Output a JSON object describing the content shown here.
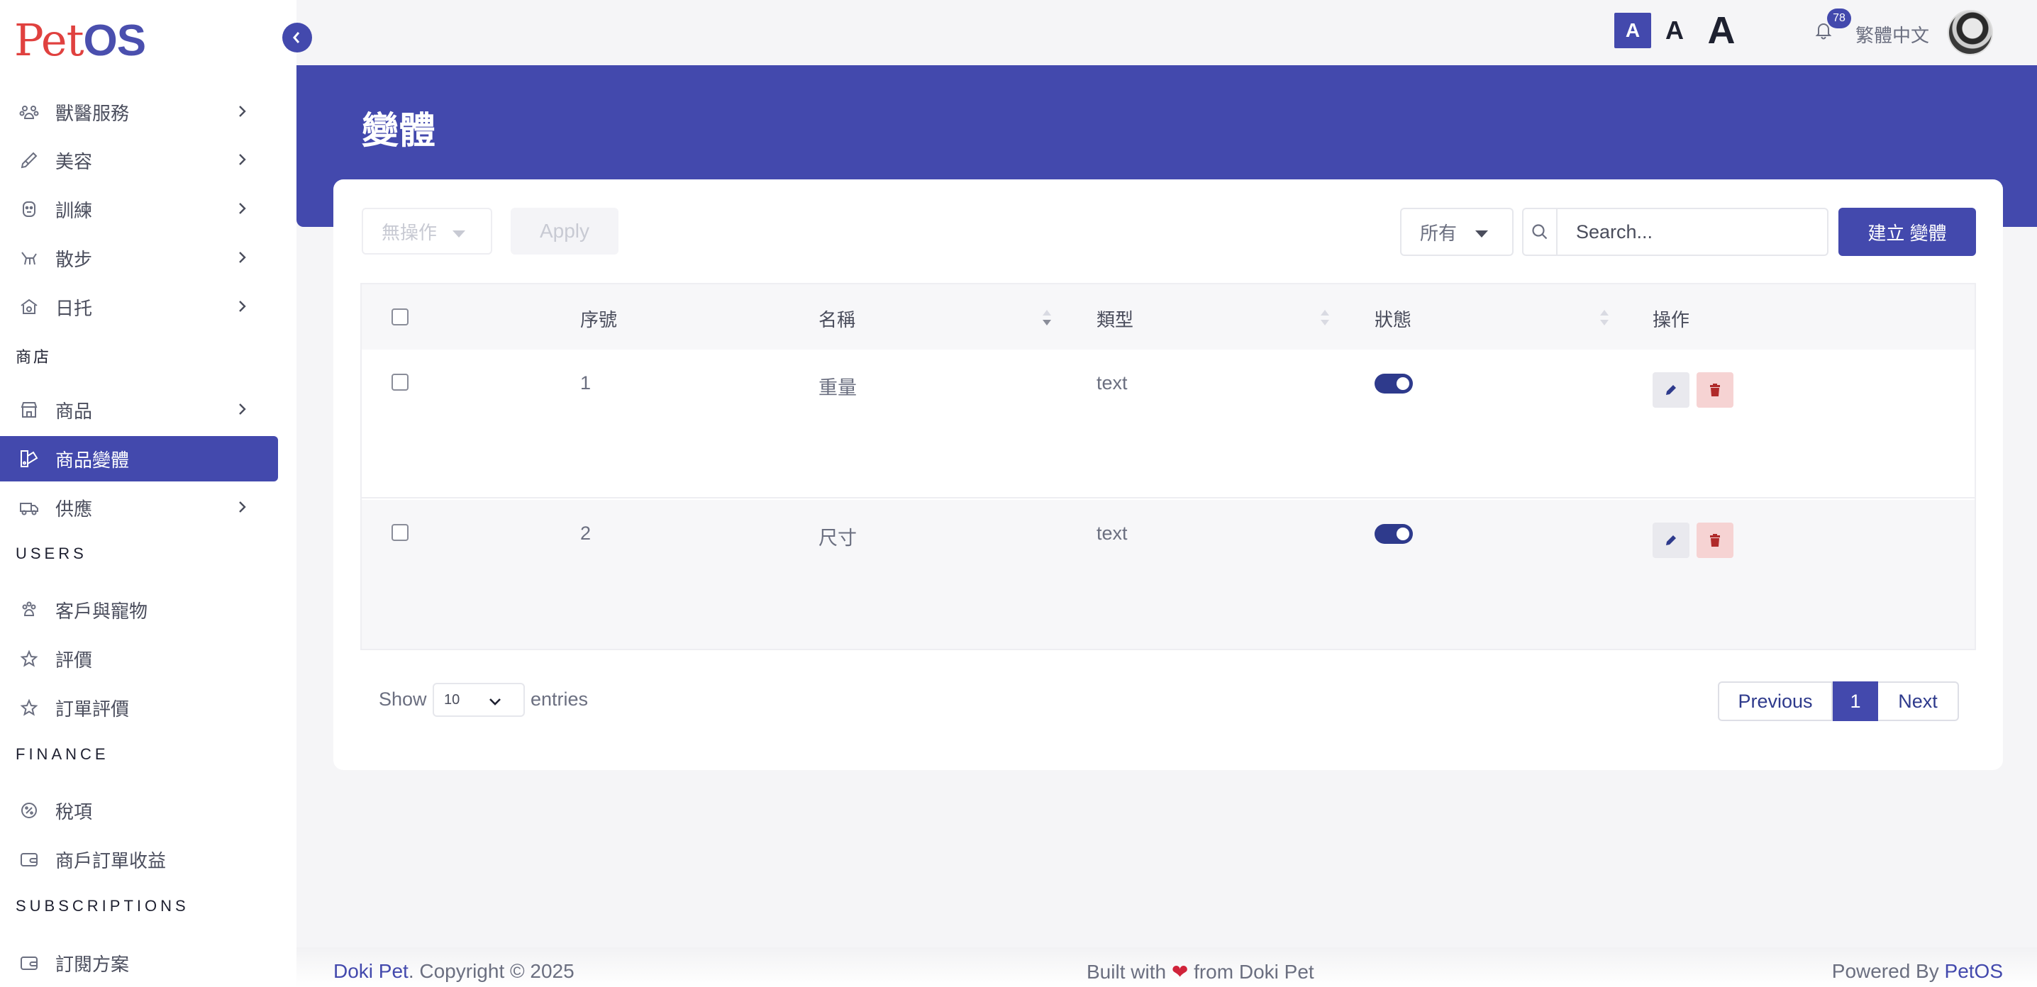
{
  "brand": {
    "logo_part1": "Pet",
    "logo_part2": "OS"
  },
  "sidebar": {
    "items": [
      {
        "label": "獸醫服務",
        "icon": "paw-group-icon",
        "has_chevron": true
      },
      {
        "label": "美容",
        "icon": "brush-icon",
        "has_chevron": true
      },
      {
        "label": "訓練",
        "icon": "dog-face-icon",
        "has_chevron": true
      },
      {
        "label": "散步",
        "icon": "dog-walk-icon",
        "has_chevron": true
      },
      {
        "label": "日托",
        "icon": "daycare-icon",
        "has_chevron": true
      }
    ],
    "section_shop": "商店",
    "shop_items": [
      {
        "label": "商品",
        "icon": "store-icon",
        "has_chevron": true
      },
      {
        "label": "商品變體",
        "icon": "variants-icon",
        "active": true
      },
      {
        "label": "供應",
        "icon": "truck-icon",
        "has_chevron": true
      }
    ],
    "section_users": "USERS",
    "user_items": [
      {
        "label": "客戶與寵物",
        "icon": "paw-icon"
      },
      {
        "label": "評價",
        "icon": "star-icon"
      },
      {
        "label": "訂單評價",
        "icon": "star-icon"
      }
    ],
    "section_finance": "FINANCE",
    "finance_items": [
      {
        "label": "稅項",
        "icon": "tax-icon"
      },
      {
        "label": "商戶訂單收益",
        "icon": "wallet-icon"
      }
    ],
    "section_subscriptions": "SUBSCRIPTIONS",
    "subscription_items": [
      {
        "label": "訂閱方案",
        "icon": "wallet-icon"
      }
    ]
  },
  "topbar": {
    "font_small": "A",
    "font_medium": "A",
    "font_large": "A",
    "notification_count": "78",
    "language": "繁體中文"
  },
  "page": {
    "title": "變體"
  },
  "toolbar": {
    "bulk_action": "無操作",
    "apply_label": "Apply",
    "filter_value": "所有",
    "search_placeholder": "Search...",
    "create_label": "建立 變體"
  },
  "table": {
    "headers": {
      "index": "序號",
      "name": "名稱",
      "type": "類型",
      "status": "狀態",
      "actions": "操作"
    },
    "rows": [
      {
        "index": "1",
        "name": "重量",
        "type": "text",
        "status_on": true
      },
      {
        "index": "2",
        "name": "尺寸",
        "type": "text",
        "status_on": true
      }
    ]
  },
  "pagination": {
    "show_label": "Show",
    "entries_value": "10",
    "entries_label": "entries",
    "previous": "Previous",
    "current_page": "1",
    "next": "Next"
  },
  "footer": {
    "company": "Doki Pet",
    "copyright": ". Copyright © 2025",
    "built_prefix": "Built with ",
    "built_suffix": " from Doki Pet",
    "powered_prefix": "Powered By ",
    "powered_brand": "PetOS"
  },
  "colors": {
    "primary": "#4349ad",
    "danger_bg": "#f6d3d3",
    "danger_icon": "#b02a2a"
  }
}
